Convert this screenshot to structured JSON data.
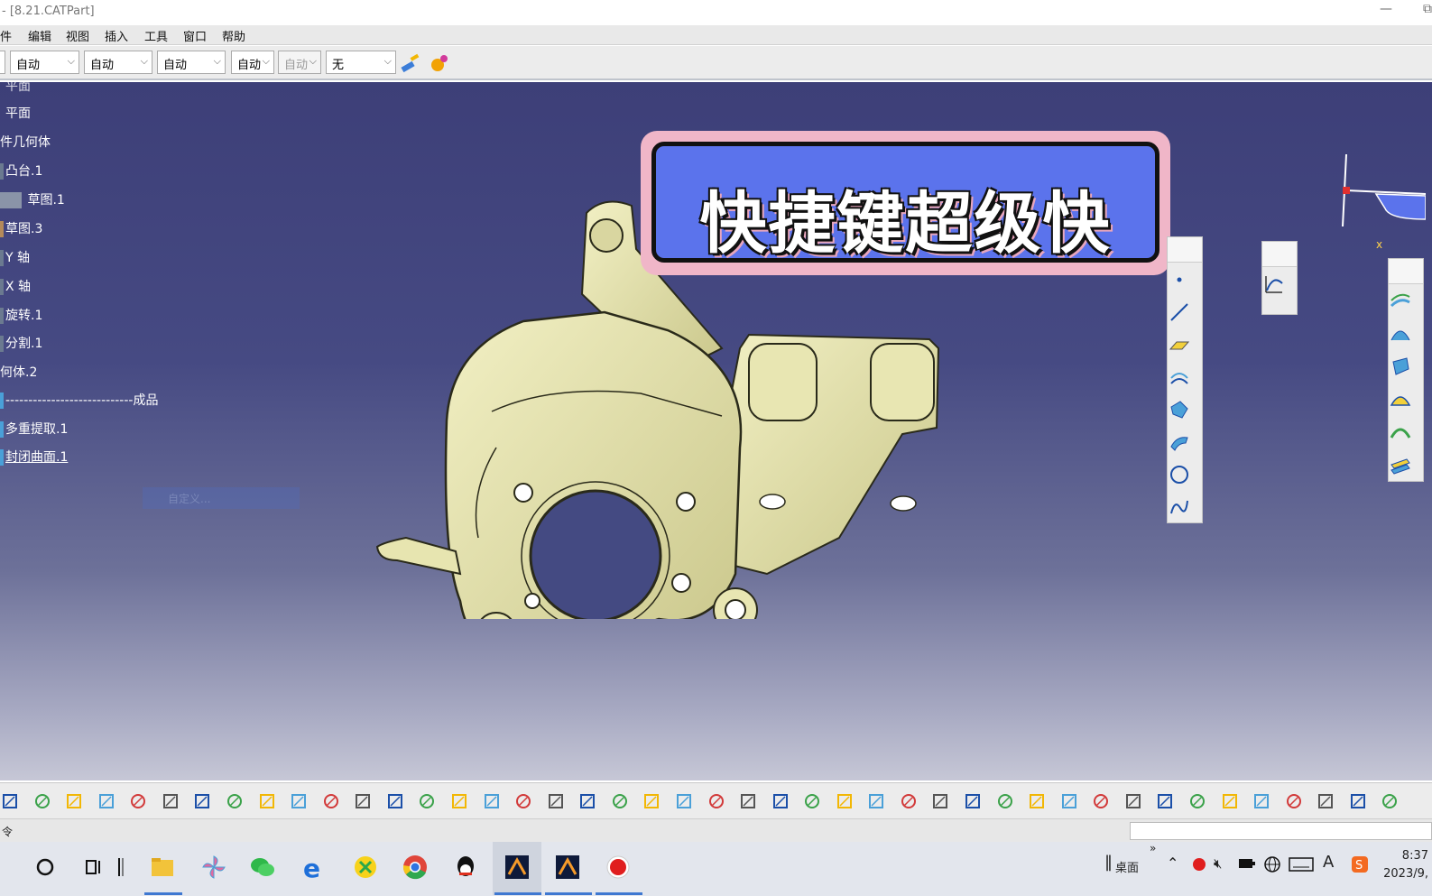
{
  "window": {
    "title": "- [8.21.CATPart]",
    "minimize": "—",
    "restore": "⧉"
  },
  "menu": [
    "件",
    "编辑",
    "视图",
    "插入",
    "工具",
    "窗口",
    "帮助"
  ],
  "toolbar_top": {
    "selects": [
      "自动",
      "自动",
      "自动",
      "自动",
      "自动",
      "无"
    ],
    "icons": [
      "paint-brush-icon",
      "magic-wand-icon"
    ]
  },
  "tree": [
    {
      "label": "平面",
      "link": false
    },
    {
      "label": "平面",
      "link": false
    },
    {
      "label": "件几何体",
      "link": false
    },
    {
      "label": "凸台.1",
      "link": false
    },
    {
      "label": "草图.1",
      "link": false
    },
    {
      "label": "草图.3",
      "link": false
    },
    {
      "label": "Y 轴",
      "link": false
    },
    {
      "label": "X 轴",
      "link": false
    },
    {
      "label": "旋转.1",
      "link": false
    },
    {
      "label": "分割.1",
      "link": false
    },
    {
      "label": "何体.2",
      "link": false
    },
    {
      "label": "----------------------------成品",
      "link": false
    },
    {
      "label": "多重提取.1",
      "link": false
    },
    {
      "label": "封闭曲面.1",
      "link": true
    }
  ],
  "ghost_label": "自定义...",
  "banner": {
    "text": "快捷键超级快"
  },
  "compass": {
    "axis_label": "x"
  },
  "right_toolbars": {
    "wireframe_icons": [
      "point-icon",
      "line-icon",
      "plane-icon",
      "extrude-surface-icon",
      "fill-surface-icon",
      "blend-surface-icon",
      "circle-icon",
      "spline-icon"
    ],
    "law_icons": [
      "law-curve-icon"
    ],
    "surface_icons": [
      "offset-surface-icon",
      "sweep-surface-icon",
      "multi-section-icon",
      "fill-icon",
      "blend-icon",
      "join-icon"
    ]
  },
  "bottom_toolbar_icons": [
    "save-icon",
    "print-icon",
    "cut-icon",
    "copy-icon",
    "paste-icon",
    "undo-icon",
    "redo-icon",
    "whats-this-icon",
    "formula-icon",
    "comment-icon",
    "knowledge-icon",
    "table-icon",
    "design-table-icon",
    "lock-icon",
    "catalog-icon",
    "fly-mode-icon",
    "fit-all-icon",
    "pan-icon",
    "rotate-icon",
    "zoom-in-icon",
    "zoom-out-icon",
    "normal-view-icon",
    "multi-view-icon",
    "iso-view-icon",
    "shading-icon",
    "hide-show-icon",
    "swap-visible-icon",
    "update-icon",
    "measure-between-icon",
    "measure-item-icon",
    "measure-inertia-icon",
    "capture-icon",
    "axis-system-icon",
    "sketch-icon",
    "sketch-positioned-icon",
    "snap-icon",
    "grid-icon",
    "3d-compass-icon",
    "analysis-icon",
    "wireframe-icon",
    "surface-icon",
    "solid-icon",
    "frame-icon",
    "exit-icon"
  ],
  "cmdbar": {
    "label": "令"
  },
  "taskbar": {
    "apps": [
      "search-icon",
      "task-view-icon",
      "file-explorer-icon",
      "pinwheel-app-icon",
      "wechat-icon",
      "edge-icon",
      "music-app-icon",
      "chrome-icon",
      "qq-icon",
      "catia-icon",
      "catia-icon-2",
      "record-icon"
    ],
    "tray": {
      "desktop": "桌面",
      "chevron": "»"
    },
    "clock": {
      "time": "8:37",
      "date": "2023/9,"
    }
  },
  "colors": {
    "viewport_top": "#3d3f78",
    "part": "#e5e3ac",
    "banner_fill": "#5b73ec",
    "banner_border": "#f0b6c8"
  }
}
